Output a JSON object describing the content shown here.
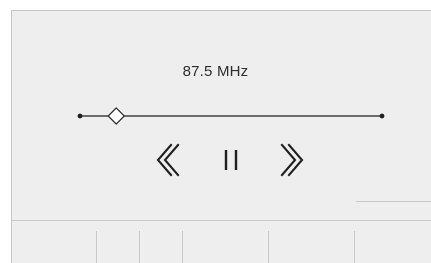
{
  "radio": {
    "frequency": "87.5 MHz",
    "tuning_position": 0.12
  },
  "controls": {
    "previous_icon": "double-chevron-left-icon",
    "pause_icon": "pause-icon",
    "next_icon": "double-chevron-right-icon"
  },
  "soft_keys": [
    {
      "label": ""
    },
    {
      "label": ""
    },
    {
      "label": ""
    },
    {
      "label": ""
    },
    {
      "label": ""
    },
    {
      "label": ""
    },
    {
      "label": ""
    }
  ],
  "colors": {
    "background": "#eeeeee",
    "outer_background": "#ffffff",
    "text": "#2d2d2d",
    "line": "#1f1f1f",
    "divider": "#c8c8c8"
  }
}
